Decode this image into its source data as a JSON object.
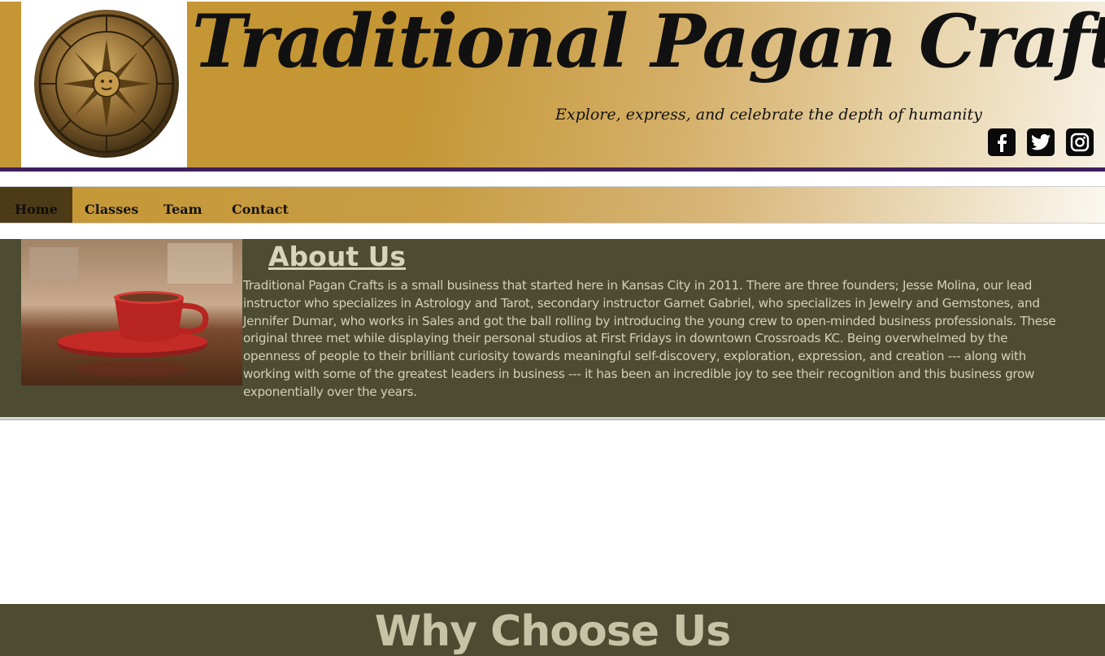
{
  "header": {
    "title": "Traditional Pagan Crafts",
    "tagline": "Explore, express, and celebrate the depth of humanity",
    "logo_icon": "zodiac-medallion-icon",
    "social": [
      {
        "name": "facebook",
        "icon": "facebook-icon"
      },
      {
        "name": "twitter",
        "icon": "twitter-icon"
      },
      {
        "name": "instagram",
        "icon": "instagram-icon"
      }
    ],
    "colors": {
      "gold": "#c49634",
      "purple_border": "#3d1f5e"
    }
  },
  "nav": {
    "items": [
      {
        "label": "Home",
        "active": true
      },
      {
        "label": "Classes",
        "active": false
      },
      {
        "label": "Team",
        "active": false
      },
      {
        "label": "Contact",
        "active": false
      }
    ],
    "active_color": "#4d3a16"
  },
  "about": {
    "title": "About Us",
    "image": "red-coffee-cup-photo",
    "text": "Traditional Pagan Crafts is a small business that started here in Kansas City in 2011. There are three founders; Jesse Molina, our lead instructor who specializes in Astrology and Tarot, secondary instructor Garnet Gabriel, who specializes in Jewelry and Gemstones, and Jennifer Dumar, who works in Sales and got the ball rolling by introducing the young crew to open-minded business professionals. These original three met while displaying their personal studios at First Fridays in downtown Crossroads KC. Being overwhelmed by the openness of people to their brilliant curiosity towards meaningful self-discovery, exploration, expression, and creation --- along with working with some of the greatest leaders in business --- it has been an incredible joy to see their recognition and this business grow exponentially over the years.",
    "background": "#4d4c33"
  },
  "why": {
    "title": "Why Choose Us"
  }
}
